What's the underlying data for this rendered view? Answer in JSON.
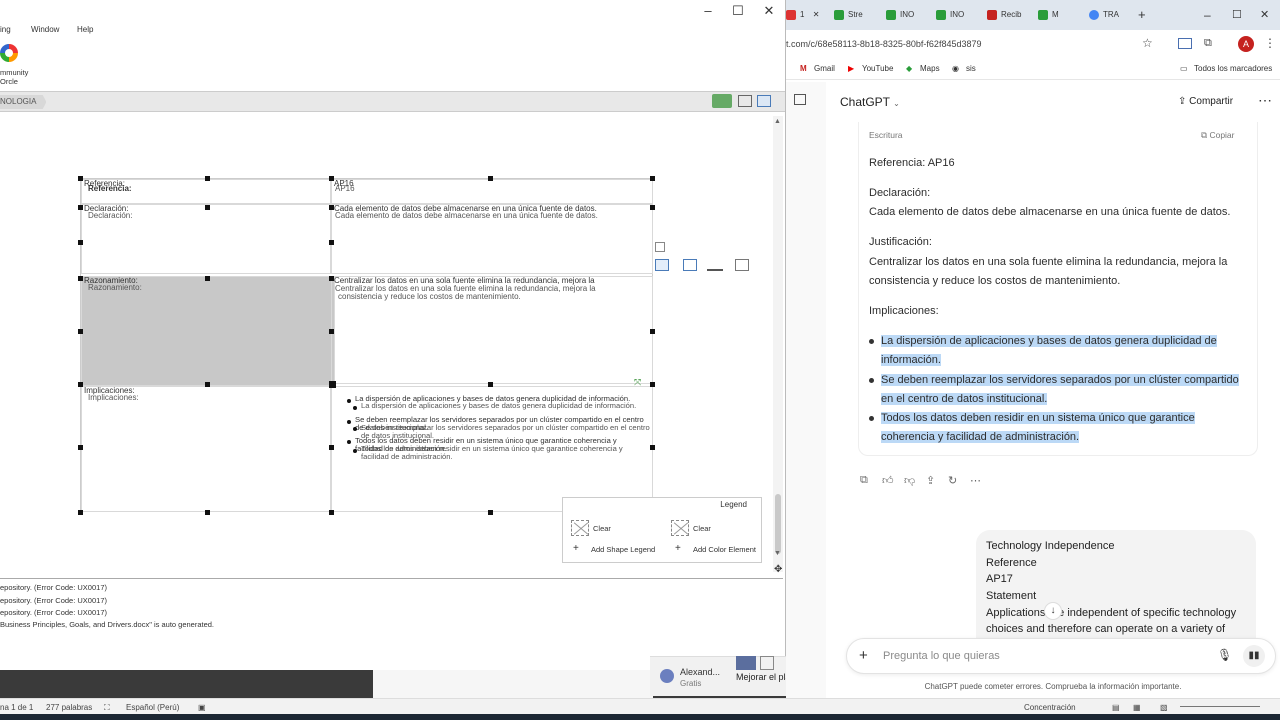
{
  "app": {
    "menu": [
      "ing",
      "Window",
      "Help"
    ],
    "ribbon_label": "mmunity\nOrcle",
    "ribbon_line1": "mmunity",
    "ribbon_line2": "Orcle",
    "breadcrumb": "NOLOGIA",
    "table": {
      "rows": [
        {
          "label_a": "Referencia:",
          "label_b": "Referencia:",
          "value_a": "AP16",
          "value_b": "AP16"
        },
        {
          "label_a": "Declaración:",
          "label_b": "Declaración:",
          "value_a": "Cada elemento de datos debe almacenarse en una única fuente de datos.",
          "value_b": "Cada elemento de datos debe almacenarse en una única fuente de datos."
        },
        {
          "label_a": "Razonamiento:",
          "label_b": "Razonamiento:",
          "value_a": "Centralizar los datos en una sola fuente elimina la redundancia, mejora la",
          "value_b": "Centralizar los datos en una sola fuente elimina la redundancia, mejora la",
          "value_c": "consistencia y reduce los costos de mantenimiento."
        },
        {
          "label_a": "Implicaciones:",
          "label_b": "Implicaciones:"
        }
      ],
      "bullets": [
        "La dispersión de aplicaciones y bases de datos genera duplicidad de información.",
        "Se deben reemplazar los servidores separados por un clúster compartido en el centro de datos institucional.",
        "Todos los datos deben residir en un sistema único que garantice coherencia y facilidad de administración."
      ]
    },
    "legend": {
      "title": "Legend",
      "clear1": "Clear",
      "clear2": "Clear",
      "add_shape": "Add Shape Legend",
      "add_color": "Add Color Element"
    },
    "output": [
      "epository. (Error Code: UX0017)",
      "epository. (Error Code: UX0017)",
      "epository. (Error Code: UX0017)",
      "Business Principles, Goals, and Drivers.docx\" is auto generated."
    ],
    "teams": {
      "name": "Alexand...",
      "sub": "Gratis",
      "upgrade": "Mejorar el plan"
    }
  },
  "word_status": {
    "page": "na 1 de 1",
    "words": "277 palabras",
    "lang": "Español (Perú)",
    "focus": "Concentración"
  },
  "chrome": {
    "tabs": [
      {
        "label": "1",
        "color": "#d33"
      },
      {
        "label": "Stre",
        "color": "#2a9d3a"
      },
      {
        "label": "INO",
        "color": "#2a9d3a"
      },
      {
        "label": "INO",
        "color": "#2a9d3a"
      },
      {
        "label": "Recib",
        "color": "#c5221f"
      },
      {
        "label": "M",
        "color": "#2a9d3a"
      },
      {
        "label": "TRA",
        "color": "#4285f4"
      }
    ],
    "url": "t.com/c/68e58113-8b18-8325-80bf-f62f845d3879",
    "profile_initial": "A",
    "bookmarks": [
      "Gmail",
      "YouTube",
      "Maps",
      "sis"
    ],
    "all_bookmarks": "Todos los marcadores"
  },
  "chat": {
    "title": "ChatGPT",
    "share": "Compartir",
    "card_label": "Escritura",
    "copy": "Copiar",
    "ref": "Referencia: AP16",
    "decl_h": "Declaración:",
    "decl": "Cada elemento de datos debe almacenarse en una única fuente de datos.",
    "just_h": "Justificación:",
    "just_1": "Centralizar los datos en una sola fuente elimina la redundancia, mejora la",
    "just_2": "consistencia y reduce los costos de mantenimiento.",
    "impl_h": "Implicaciones:",
    "bullets": [
      [
        "La dispersión de aplicaciones y bases de datos genera duplicidad de",
        "información."
      ],
      [
        "Se deben reemplazar los servidores separados por un clúster compartido",
        "en el centro de datos institucional."
      ],
      [
        "Todos los datos deben residir en un sistema único que garantice",
        "coherencia y facilidad de administración."
      ]
    ],
    "user_lines": [
      "Technology Independence",
      "Reference",
      "AP17",
      "Statement",
      "Applications are independent of specific technology",
      "choices and therefore can operate on a variety of"
    ],
    "placeholder": "Pregunta lo que quieras",
    "disclaimer": "ChatGPT puede cometer errores. Comprueba la información importante."
  },
  "colors": {
    "highlight": "#bcd9f6",
    "selection": "#c8c8c8"
  }
}
